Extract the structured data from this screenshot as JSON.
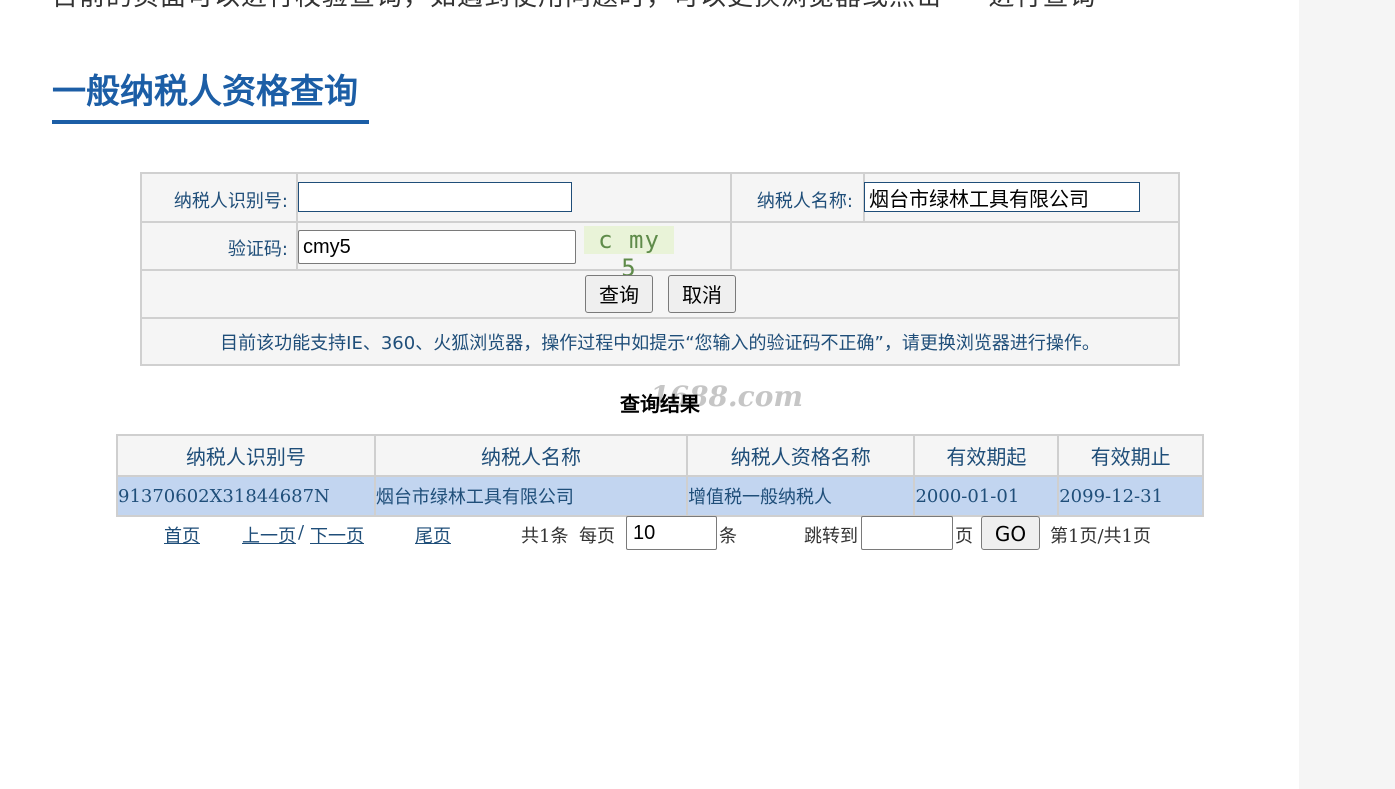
{
  "page": {
    "top_text": "目前的页面可以进行校验查询，如遇到使用问题时，可以更换浏览器或点击 一 进行查询",
    "title": "一般纳税人资格查询"
  },
  "form": {
    "taxpayer_id_label": "纳税人识别号:",
    "taxpayer_id_value": "",
    "taxpayer_name_label": "纳税人名称:",
    "taxpayer_name_value": "烟台市绿林工具有限公司",
    "captcha_label": "验证码:",
    "captcha_value": "cmy5",
    "captcha_image_text": "c my 5",
    "query_button": "查询",
    "cancel_button": "取消",
    "notice": "目前该功能支持IE、360、火狐浏览器，操作过程中如提示“您输入的验证码不正确”，请更换浏览器进行操作。"
  },
  "results": {
    "title": "查询结果",
    "watermark": "1688.com",
    "columns": [
      "纳税人识别号",
      "纳税人名称",
      "纳税人资格名称",
      "有效期起",
      "有效期止"
    ],
    "rows": [
      [
        "91370602X31844687N",
        "烟台市绿林工具有限公司",
        "增值税一般纳税人",
        "2000-01-01",
        "2099-12-31"
      ]
    ]
  },
  "pager": {
    "first": "首页",
    "prev": "上一页",
    "sep": "/",
    "next": "下一页",
    "last": "尾页",
    "total": "共1条",
    "per_page_label": "每页",
    "per_page_value": "10",
    "per_page_unit": "条",
    "jump_label": "跳转到",
    "jump_value": "",
    "jump_unit": "页",
    "go_button": "GO",
    "page_info": "第1页/共1页"
  },
  "colors": {
    "accent": "#1c5ea6",
    "label_text": "#1f4e79",
    "row_highlight": "#c2d5f0"
  }
}
